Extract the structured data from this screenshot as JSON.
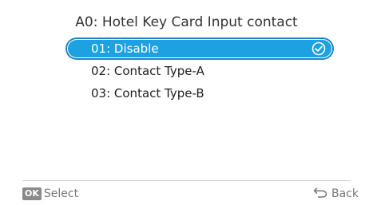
{
  "screen": {
    "title": "A0: Hotel Key Card Input contact"
  },
  "menu": {
    "items": [
      {
        "label": "01: Disable",
        "selected": true
      },
      {
        "label": "02: Contact Type-A",
        "selected": false
      },
      {
        "label": "03: Contact Type-B",
        "selected": false
      }
    ]
  },
  "footer": {
    "ok_key": "OK",
    "select_label": "Select",
    "back_label": "Back"
  },
  "colors": {
    "accent": "#1da1e0",
    "accent_border": "#1b84c4",
    "footer_text": "#777777",
    "divider": "#cccccc"
  },
  "icons": {
    "selected_indicator": "check-circle-icon",
    "back": "back-arrow-icon"
  }
}
